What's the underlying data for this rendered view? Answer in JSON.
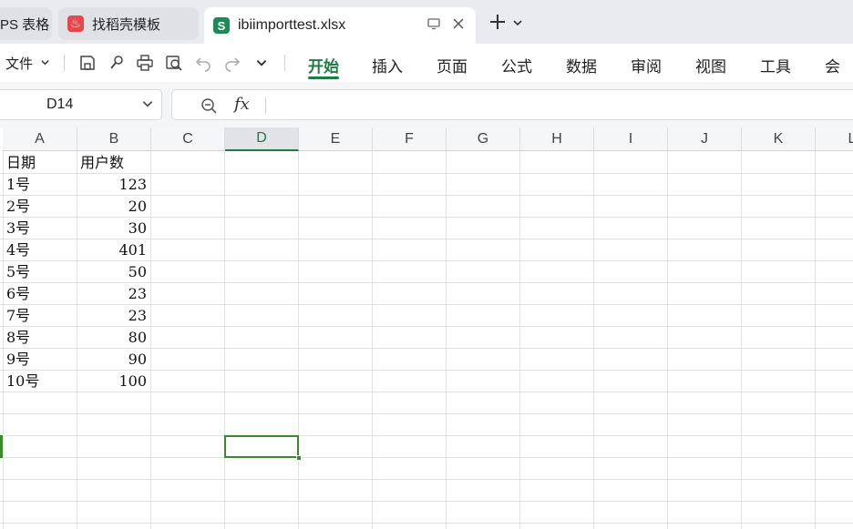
{
  "tabs": [
    {
      "label": "PS 表格"
    },
    {
      "label": "找稻壳模板",
      "icon_text": "♨"
    },
    {
      "label": "ibiimporttest.xlsx",
      "icon_text": "S"
    }
  ],
  "menu": {
    "file_label": "文件",
    "ribbon_tabs": [
      "开始",
      "插入",
      "页面",
      "公式",
      "数据",
      "审阅",
      "视图",
      "工具",
      "会员"
    ]
  },
  "formula": {
    "cell_ref": "D14",
    "fx_label": "fx",
    "content": ""
  },
  "columns": [
    "A",
    "B",
    "C",
    "D",
    "E",
    "F",
    "G",
    "H",
    "I",
    "J",
    "K",
    "L"
  ],
  "selected_column": "D",
  "table": {
    "header": [
      "日期",
      "用户数"
    ],
    "rows": [
      [
        "1号",
        "123"
      ],
      [
        "2号",
        "20"
      ],
      [
        "3号",
        "30"
      ],
      [
        "4号",
        "401"
      ],
      [
        "5号",
        "50"
      ],
      [
        "6号",
        "23"
      ],
      [
        "7号",
        "23"
      ],
      [
        "8号",
        "80"
      ],
      [
        "9号",
        "90"
      ],
      [
        "10号",
        "100"
      ]
    ]
  },
  "colors": {
    "accent": "#1f7a43",
    "selection": "#3a8a2a",
    "sheet_icon": "#1d8c54",
    "daoke_icon": "#e8474b"
  }
}
